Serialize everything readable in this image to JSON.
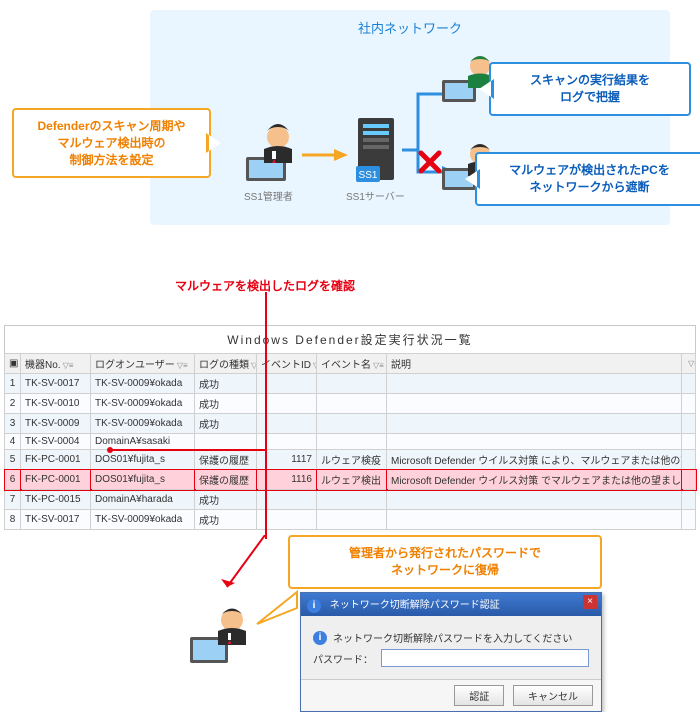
{
  "network": {
    "title": "社内ネットワーク",
    "admin_label": "SS1管理者",
    "server_label": "SS1サーバー",
    "callout_left": [
      "Defenderのスキャン周期や",
      "マルウェア検出時の",
      "制御方法を設定"
    ],
    "callout_top_right": [
      "スキャンの実行結果を",
      "ログで把握"
    ],
    "callout_bottom_right": [
      "マルウェアが検出されたPCを",
      "ネットワークから遮断"
    ]
  },
  "red_caption": "マルウェアを検出したログを確認",
  "table": {
    "title": "Windows  Defender設定実行状況一覧",
    "columns": [
      "機器No.",
      "ログオンユーザー",
      "ログの種類",
      "イベントID",
      "イベント名",
      "説明"
    ],
    "rows": [
      {
        "n": "1",
        "c": [
          "TK-SV-0017",
          "TK-SV-0009¥okada",
          "成功",
          "",
          "",
          ""
        ]
      },
      {
        "n": "2",
        "c": [
          "TK-SV-0010",
          "TK-SV-0009¥okada",
          "成功",
          "",
          "",
          ""
        ]
      },
      {
        "n": "3",
        "c": [
          "TK-SV-0009",
          "TK-SV-0009¥okada",
          "成功",
          "",
          "",
          ""
        ]
      },
      {
        "n": "4",
        "c": [
          "TK-SV-0004",
          "DomainA¥sasaki",
          "",
          "",
          "",
          ""
        ]
      },
      {
        "n": "5",
        "c": [
          "FK-PC-0001",
          "DOS01¥fujita_s",
          "保護の履歴",
          "1117",
          "ルウェア検疫",
          "Microsoft  Defender ウイルス対策 により、マルウェアまたは他の望ましくない可能性のあるソフトウェアからこのコン"
        ]
      },
      {
        "n": "6",
        "c": [
          "FK-PC-0001",
          "DOS01¥fujita_s",
          "保護の履歴",
          "1116",
          "ルウェア検出",
          "Microsoft  Defender ウイルス対策 でマルウェアまたは他の望ましくない可能性のあるソフトウェアが検出されました。"
        ],
        "highlight": true
      },
      {
        "n": "7",
        "c": [
          "TK-PC-0015",
          "DomainA¥harada",
          "成功",
          "",
          "",
          ""
        ]
      },
      {
        "n": "8",
        "c": [
          "TK-SV-0017",
          "TK-SV-0009¥okada",
          "成功",
          "",
          "",
          ""
        ]
      }
    ]
  },
  "recovery": {
    "callout": [
      "管理者から発行されたパスワードで",
      "ネットワークに復帰"
    ],
    "dialog": {
      "title": "ネットワーク切断解除パスワード認証",
      "message": "ネットワーク切断解除パスワードを入力してください",
      "pwd_label": "パスワード：",
      "btn_ok": "認証",
      "btn_cancel": "キャンセル"
    }
  }
}
